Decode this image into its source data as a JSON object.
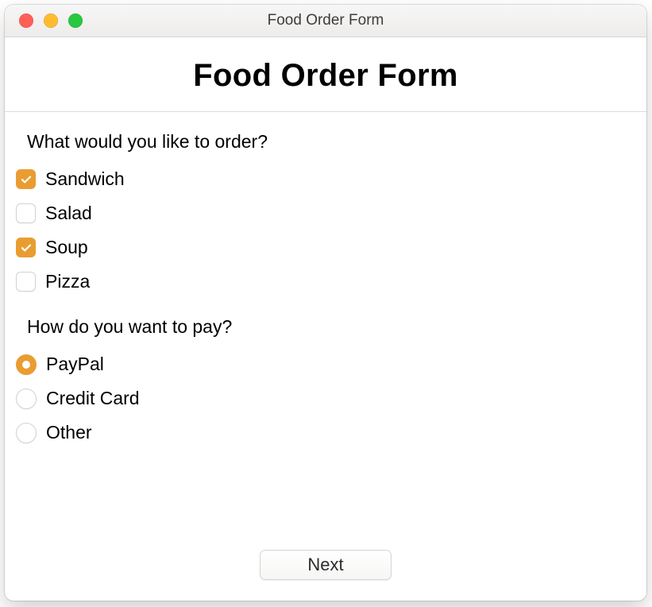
{
  "window": {
    "title": "Food Order Form"
  },
  "header": {
    "title": "Food Order Form"
  },
  "questions": {
    "order": {
      "prompt": "What would you like to order?",
      "options": [
        {
          "label": "Sandwich",
          "checked": true
        },
        {
          "label": "Salad",
          "checked": false
        },
        {
          "label": "Soup",
          "checked": true
        },
        {
          "label": "Pizza",
          "checked": false
        }
      ]
    },
    "payment": {
      "prompt": "How do you want to pay?",
      "options": [
        {
          "label": "PayPal",
          "selected": true
        },
        {
          "label": "Credit Card",
          "selected": false
        },
        {
          "label": "Other",
          "selected": false
        }
      ]
    }
  },
  "actions": {
    "next": "Next"
  },
  "colors": {
    "accent": "#e99d31"
  }
}
